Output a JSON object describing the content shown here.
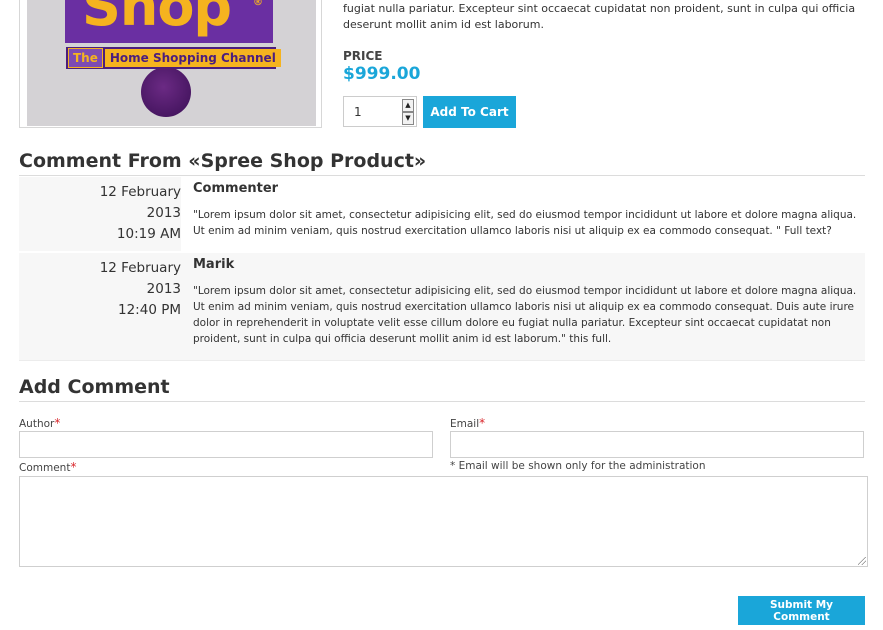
{
  "product": {
    "image_alt": "Shop",
    "logo_main": "Shop",
    "logo_mark": "®",
    "logo_the": "The",
    "logo_channel": "Home Shopping Channel",
    "description_tail": "fugiat nulla pariatur. Excepteur sint occaecat cupidatat non proident, sunt in culpa qui officia deserunt mollit anim id est laborum.",
    "price_label": "PRICE",
    "price_value": "$999.00",
    "quantity": "1",
    "add_to_cart_label": "Add To Cart"
  },
  "comments_section": {
    "title": "Comment From «Spree Shop Product»",
    "items": [
      {
        "date_day": "12 February",
        "date_year": "2013",
        "time": "10:19 AM",
        "author": "Commenter",
        "text": "\"Lorem ipsum dolor sit amet, consectetur adipisicing elit, sed do eiusmod tempor incididunt ut labore et dolore magna aliqua. Ut enim ad minim veniam, quis nostrud exercitation ullamco laboris nisi ut aliquip ex ea commodo consequat. \" Full text?"
      },
      {
        "date_day": "12 February",
        "date_year": "2013",
        "time": "12:40 PM",
        "author": "Marik",
        "text": "\"Lorem ipsum dolor sit amet, consectetur adipisicing elit, sed do eiusmod tempor incididunt ut labore et dolore magna aliqua. Ut enim ad minim veniam, quis nostrud exercitation ullamco laboris nisi ut aliquip ex ea commodo consequat. Duis aute irure dolor in reprehenderit in voluptate velit esse cillum dolore eu fugiat nulla pariatur. Excepteur sint occaecat cupidatat non proident, sunt in culpa qui officia deserunt mollit anim id est laborum.\" this full."
      }
    ]
  },
  "add_comment": {
    "title": "Add Comment",
    "author_label": "Author",
    "email_label": "Email",
    "comment_label": "Comment",
    "required_mark": "*",
    "author_value": "",
    "email_value": "",
    "comment_value": "",
    "email_note": "* Email will be shown only for the administration",
    "submit_label": "Submit My Comment"
  },
  "colors": {
    "accent": "#1aa6d9",
    "required": "#d9262b"
  }
}
